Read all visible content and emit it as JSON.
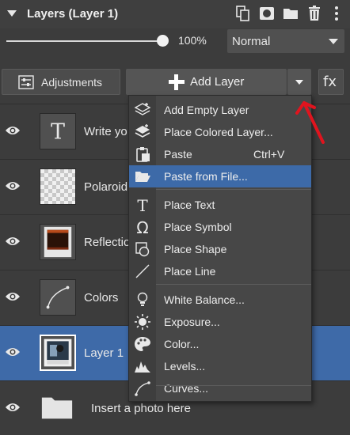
{
  "header": {
    "title": "Layers (Layer 1)"
  },
  "opacity": {
    "value": "100%",
    "level": 1.0
  },
  "blend_mode": {
    "selected": "Normal"
  },
  "buttons": {
    "adjustments": "Adjustments",
    "add_layer": "Add Layer",
    "fx": "fx"
  },
  "layers": [
    {
      "name": "Write yo",
      "thumb": "text",
      "visible": true,
      "selected": false
    },
    {
      "name": "Polaroid",
      "thumb": "checker",
      "visible": true,
      "selected": false
    },
    {
      "name": "Reflectio",
      "thumb": "frame",
      "visible": true,
      "selected": false
    },
    {
      "name": "Colors",
      "thumb": "curve",
      "visible": true,
      "selected": false
    },
    {
      "name": "Layer 1",
      "thumb": "photo",
      "visible": true,
      "selected": true
    },
    {
      "name": "Insert a photo here",
      "thumb": "folder",
      "visible": true,
      "selected": false
    }
  ],
  "menu": {
    "items": [
      {
        "label": "Add Empty Layer",
        "icon": "layers-empty-icon",
        "shortcut": ""
      },
      {
        "label": "Place Colored Layer...",
        "icon": "layers-filled-icon",
        "shortcut": ""
      },
      {
        "label": "Paste",
        "icon": "clipboard-icon",
        "shortcut": "Ctrl+V"
      },
      {
        "label": "Paste from File...",
        "icon": "folder-open-icon",
        "shortcut": "",
        "highlighted": true
      },
      {
        "label": "Place Text",
        "icon": "text-icon",
        "shortcut": ""
      },
      {
        "label": "Place Symbol",
        "icon": "omega-icon",
        "shortcut": ""
      },
      {
        "label": "Place Shape",
        "icon": "shape-icon",
        "shortcut": ""
      },
      {
        "label": "Place Line",
        "icon": "line-icon",
        "shortcut": ""
      },
      {
        "label": "White Balance...",
        "icon": "bulb-icon",
        "shortcut": ""
      },
      {
        "label": "Exposure...",
        "icon": "exposure-icon",
        "shortcut": ""
      },
      {
        "label": "Color...",
        "icon": "palette-icon",
        "shortcut": ""
      },
      {
        "label": "Levels...",
        "icon": "levels-icon",
        "shortcut": ""
      },
      {
        "label": "Curves...",
        "icon": "curves-icon",
        "shortcut": ""
      }
    ]
  },
  "colors": {
    "selection": "#3e6aa8",
    "annotation_arrow": "#e0141e",
    "background": "#3c3c3c"
  }
}
